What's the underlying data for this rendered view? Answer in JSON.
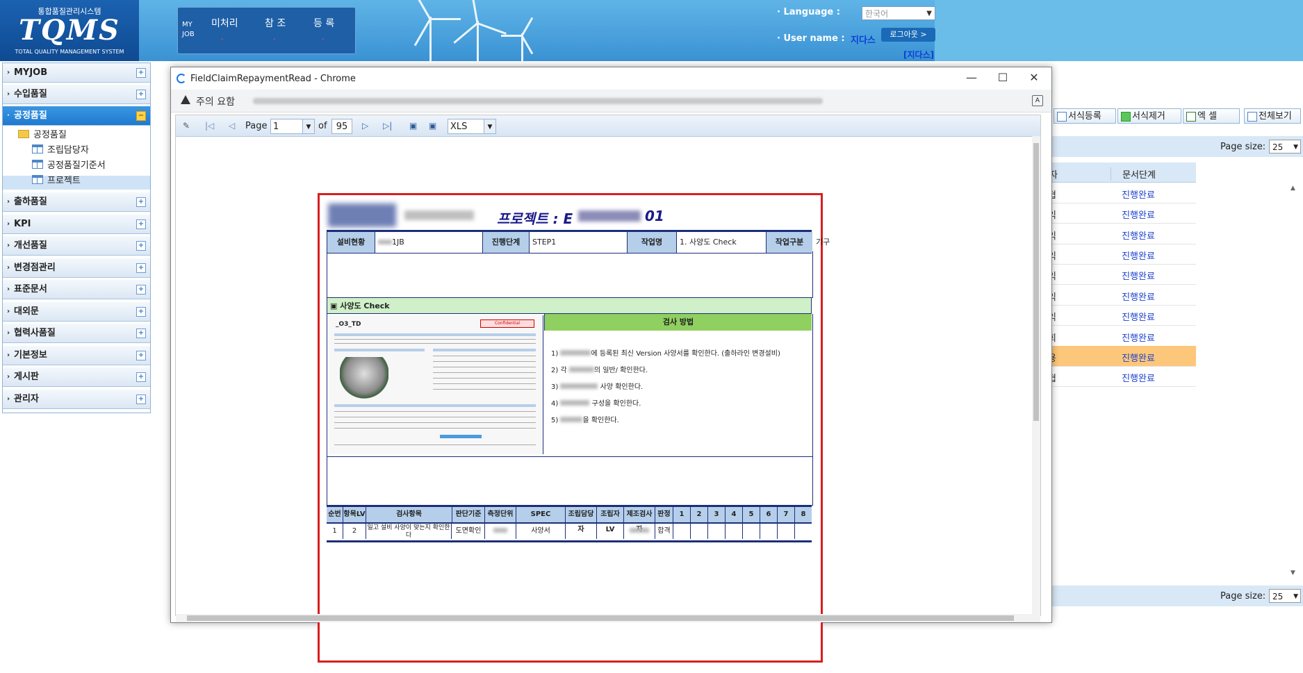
{
  "header": {
    "system_name": "통합품질관리시스템",
    "logo": "TQMS",
    "logo_sub": "TOTAL QUALITY MANAGEMENT SYSTEM",
    "myjob_label": "MY JOB",
    "myjob_tabs": [
      "미처리",
      "참 조",
      "등 록"
    ],
    "myjob_dash": "-",
    "language_label": "· Language :",
    "language_value": "한국어",
    "user_label": "· User name :",
    "user_name": "지다스",
    "logout_label": "로그아웃 >",
    "user_bracket": "[지다스]"
  },
  "sidebar": {
    "menus": [
      "MYJOB",
      "수입품질",
      "공정품질",
      "출하품질",
      "KPI",
      "개선품질",
      "변경점관리",
      "표준문서",
      "대외문",
      "협력사품질",
      "기본정보",
      "게시판",
      "관리자"
    ],
    "active_menu": "공정품질",
    "folder": "공정품질",
    "sub_items": [
      "조립담당자",
      "공정품질기준서",
      "프로젝트"
    ],
    "selected_sub": "프로젝트"
  },
  "right_panel": {
    "buttons": [
      "서식등록",
      "서식제거",
      "엑 셀",
      "전체보기"
    ],
    "page_size_label": "Page size:",
    "page_size_value": "25",
    "col_header_partial": "자",
    "col_header": "문서단계",
    "rows": [
      {
        "c1": "협",
        "c2": "진행완료"
      },
      {
        "c1": "익",
        "c2": "진행완료"
      },
      {
        "c1": "익",
        "c2": "진행완료"
      },
      {
        "c1": "익",
        "c2": "진행완료"
      },
      {
        "c1": "익",
        "c2": "진행완료"
      },
      {
        "c1": "익",
        "c2": "진행완료"
      },
      {
        "c1": "익",
        "c2": "진행완료"
      },
      {
        "c1": "희",
        "c2": "진행완료"
      },
      {
        "c1": "용",
        "c2": "진행완료"
      },
      {
        "c1": "협",
        "c2": "진행완료"
      }
    ],
    "highlight_row": 8
  },
  "popup": {
    "title": "FieldClaimRepaymentRead - Chrome",
    "warning": "주의 요함",
    "toolbar": {
      "page_label": "Page",
      "page_value": "1",
      "of_label": "of",
      "total_pages": "95",
      "format": "XLS"
    }
  },
  "report": {
    "title_prefix": "프로젝트 : E",
    "title_suffix": "01",
    "info": {
      "h1": "설비현황",
      "v1": "1JB",
      "h2": "진행단계",
      "v2": "STEP1",
      "h3": "작업명",
      "v3": "1. 사양도 Check",
      "h4": "작업구분",
      "v4": "기구"
    },
    "section_title": "▣ 사양도 Check",
    "thumb_title": "_O3_TD",
    "thumb_conf": "Confidential",
    "check_header": "검사 방법",
    "checks": [
      {
        "prefix": "1)",
        "text": "에 등록된 최신 Version 사양서를 확인한다. (출하라인 변경설비)"
      },
      {
        "prefix": "2) 각",
        "text": "의 일반/ 확인한다."
      },
      {
        "prefix": "3)",
        "text": "사양 확인한다."
      },
      {
        "prefix": "4)",
        "text": "구성을 확인한다."
      },
      {
        "prefix": "5)",
        "text": "을 확인한다."
      }
    ],
    "detail_headers": [
      "순번",
      "항목LV",
      "검사항목",
      "판단기준",
      "측정단위",
      "SPEC",
      "조립담당자",
      "조립자LV",
      "제조검사자",
      "판정",
      "1",
      "2",
      "3",
      "4",
      "5",
      "6",
      "7",
      "8"
    ],
    "detail_row": {
      "seq": "1",
      "lv": "2",
      "item": "일고 설비 사양이 맞는지 확인한다",
      "criteria": "도면확인",
      "spec": "사양서",
      "judge": "합격"
    }
  },
  "colors": {
    "accent": "#1f7ad0",
    "report_border": "#d81e1e",
    "link_blue": "#1a3fd0",
    "highlight": "#fcc77a"
  }
}
